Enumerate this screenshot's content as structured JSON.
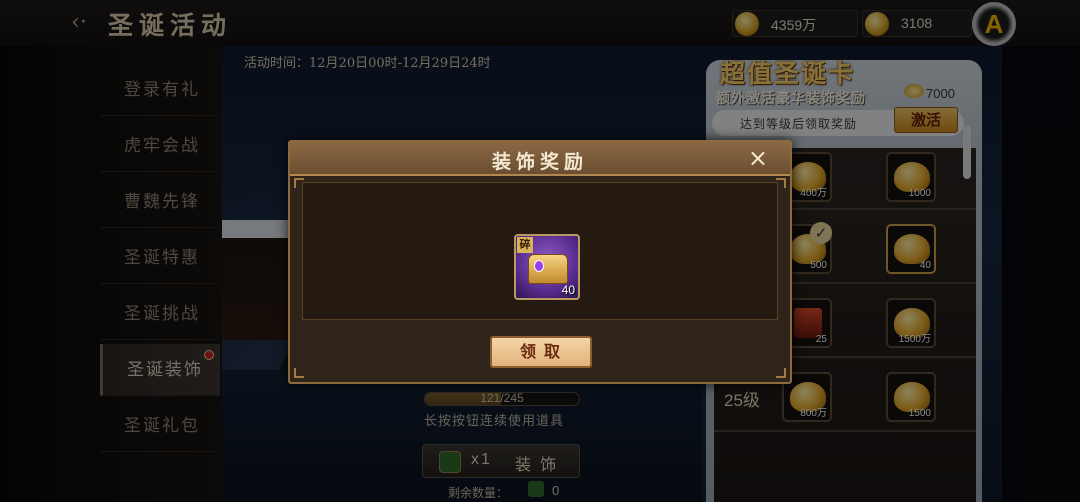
{
  "header": {
    "title": "圣诞活动",
    "coins": "4359万",
    "ingots": "3108"
  },
  "sidebar": {
    "items": [
      {
        "label": "登录有礼"
      },
      {
        "label": "虎牢会战"
      },
      {
        "label": "曹魏先锋"
      },
      {
        "label": "圣诞特惠"
      },
      {
        "label": "圣诞挑战"
      },
      {
        "label": "圣诞装饰",
        "active": true,
        "badge": true
      },
      {
        "label": "圣诞礼包"
      }
    ]
  },
  "event": {
    "time": "活动时间：12月20日00时-12月29日24时",
    "progress_text": "121/245",
    "progress_fraction": 0.494,
    "hint": "长按按钮连续使用道具",
    "decorate_qty": "x1",
    "decorate_label": "装 饰",
    "remaining_label": "剩余数量：",
    "remaining_value": "0"
  },
  "card": {
    "title": "超值圣诞卡",
    "subtitle": "额外激活豪华装饰奖励",
    "price": "7000",
    "requirement": "达到等级后领取奖励",
    "activate_label": "激活",
    "rewards": [
      {
        "count": "400万"
      },
      {
        "count": "1000"
      },
      {
        "count": "500"
      },
      {
        "count": "40"
      },
      {
        "count": "25"
      },
      {
        "count": "1500万"
      },
      {
        "count": "800万"
      },
      {
        "count": "1500"
      }
    ],
    "level_label": "25级"
  },
  "modal": {
    "title": "装饰奖励",
    "close_icon": "×",
    "item_tag": "碎",
    "item_count": "40",
    "claim_label": "领取"
  }
}
